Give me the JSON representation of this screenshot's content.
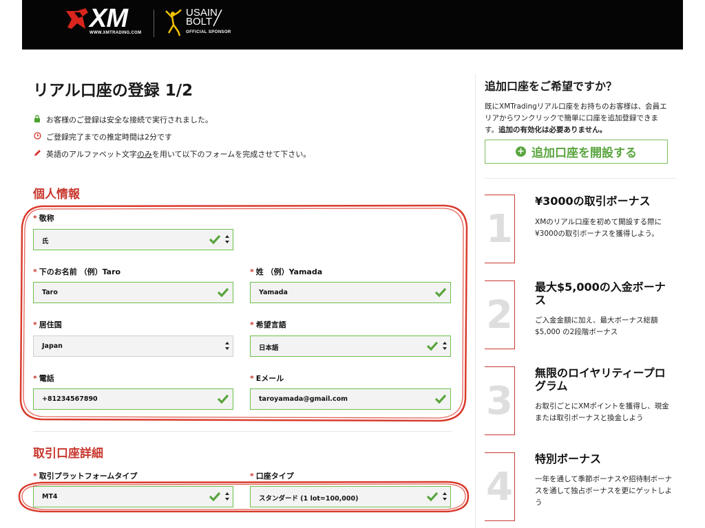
{
  "header": {
    "logo_text": "XM",
    "logo_url_text": "WWW.XMTRADING.COM",
    "sponsor_name_line1": "USAIN",
    "sponsor_name_line2": "BOLT",
    "sponsor_sub": "OFFICIAL SPONSOR"
  },
  "form": {
    "title": "リアル口座の登録 1/2",
    "notices": [
      {
        "icon": "lock-icon",
        "text": "お客様のご登録は安全な接続で実行されました。"
      },
      {
        "icon": "clock-icon",
        "text": "ご登録完了までの推定時間は2分です"
      },
      {
        "icon": "pencil-icon",
        "text_before": "英語のアルファベット文字",
        "text_underlined": "のみ",
        "text_after": "を用いて以下のフォームを完成させて下さい。"
      }
    ],
    "personal_section_title": "個人情報",
    "fields": {
      "salutation": {
        "label": "敬称",
        "value": "氏"
      },
      "first_name": {
        "label": "下のお名前 （例）Taro",
        "value": "Taro"
      },
      "last_name": {
        "label": "姓 （例）Yamada",
        "value": "Yamada"
      },
      "country": {
        "label": "居住国",
        "value": "Japan"
      },
      "language": {
        "label": "希望言語",
        "value": "日本語"
      },
      "phone": {
        "label": "電話",
        "value": "+81234567890"
      },
      "email": {
        "label": "Eメール",
        "value": "taroyamada@gmail.com"
      },
      "platform": {
        "label": "取引プラットフォームタイプ",
        "value": "MT4"
      },
      "account_type": {
        "label": "口座タイプ",
        "value": "スタンダード (1 lot=100,000)"
      }
    },
    "required_mark": "*",
    "account_section_title": "取引口座詳細"
  },
  "sidebar": {
    "promo_title": "追加口座をご希望ですか？",
    "promo_desc": "既にXMTradingリアル口座をお持ちのお客様は、会員エリアからワンクリックで簡単に口座を追加登録できます。",
    "promo_desc_bold": "追加の有効化は必要ありません。",
    "promo_button": "追加口座を開設する",
    "bonuses": [
      {
        "number": "1",
        "title": "¥3000の取引ボーナス",
        "desc": "XMのリアル口座を初めて開設する際に¥3000の取引ボーナスを獲得しよう。"
      },
      {
        "number": "2",
        "title": "最大$5,000の入金ボーナス",
        "desc": "ご入金金額に加え、最大ボーナス総額$5,000 の2段階ボーナス"
      },
      {
        "number": "3",
        "title": "無限のロイヤリティープログラム",
        "desc": "お取引ごとにXMポイントを獲得し、現金または取引ボーナスと換金しよう"
      },
      {
        "number": "4",
        "title": "特別ボーナス",
        "desc": "一年を通して季節ボーナスや招待制ボーナスを通して独占ボーナスを更にゲットしよう"
      }
    ]
  },
  "colors": {
    "accent_red": "#c8372d",
    "valid_green": "#5aa53e",
    "header_bg": "#050505"
  }
}
